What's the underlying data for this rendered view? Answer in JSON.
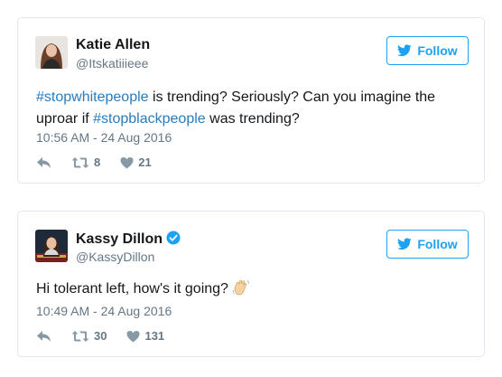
{
  "colors": {
    "brand_blue": "#1da1f2",
    "hashtag_blue": "#2b7bb9",
    "muted_gray": "#657786",
    "border": "#e1e8ed"
  },
  "tweets": [
    {
      "author_name": "Katie Allen",
      "author_handle": "@Itskatiiieee",
      "verified": false,
      "follow_label": "Follow",
      "text_parts": [
        {
          "type": "hashtag",
          "text": "#stopwhitepeople"
        },
        {
          "type": "text",
          "text": " is trending? Seriously? Can you imagine the uproar if "
        },
        {
          "type": "hashtag",
          "text": "#stopblackpeople"
        },
        {
          "type": "text",
          "text": " was trending?"
        }
      ],
      "timestamp": "10:56 AM - 24 Aug 2016",
      "retweet_count": "8",
      "like_count": "21",
      "icons": {
        "reply": "reply-icon",
        "retweet": "retweet-icon",
        "like": "heart-icon"
      }
    },
    {
      "author_name": "Kassy Dillon",
      "author_handle": "@KassyDillon",
      "verified": true,
      "follow_label": "Follow",
      "text_parts": [
        {
          "type": "text",
          "text": "Hi tolerant left, how's it going?"
        }
      ],
      "emoji": "waving-hand-emoji",
      "timestamp": "10:49 AM - 24 Aug 2016",
      "retweet_count": "30",
      "like_count": "131",
      "icons": {
        "reply": "reply-icon",
        "retweet": "retweet-icon",
        "like": "heart-icon"
      }
    }
  ]
}
